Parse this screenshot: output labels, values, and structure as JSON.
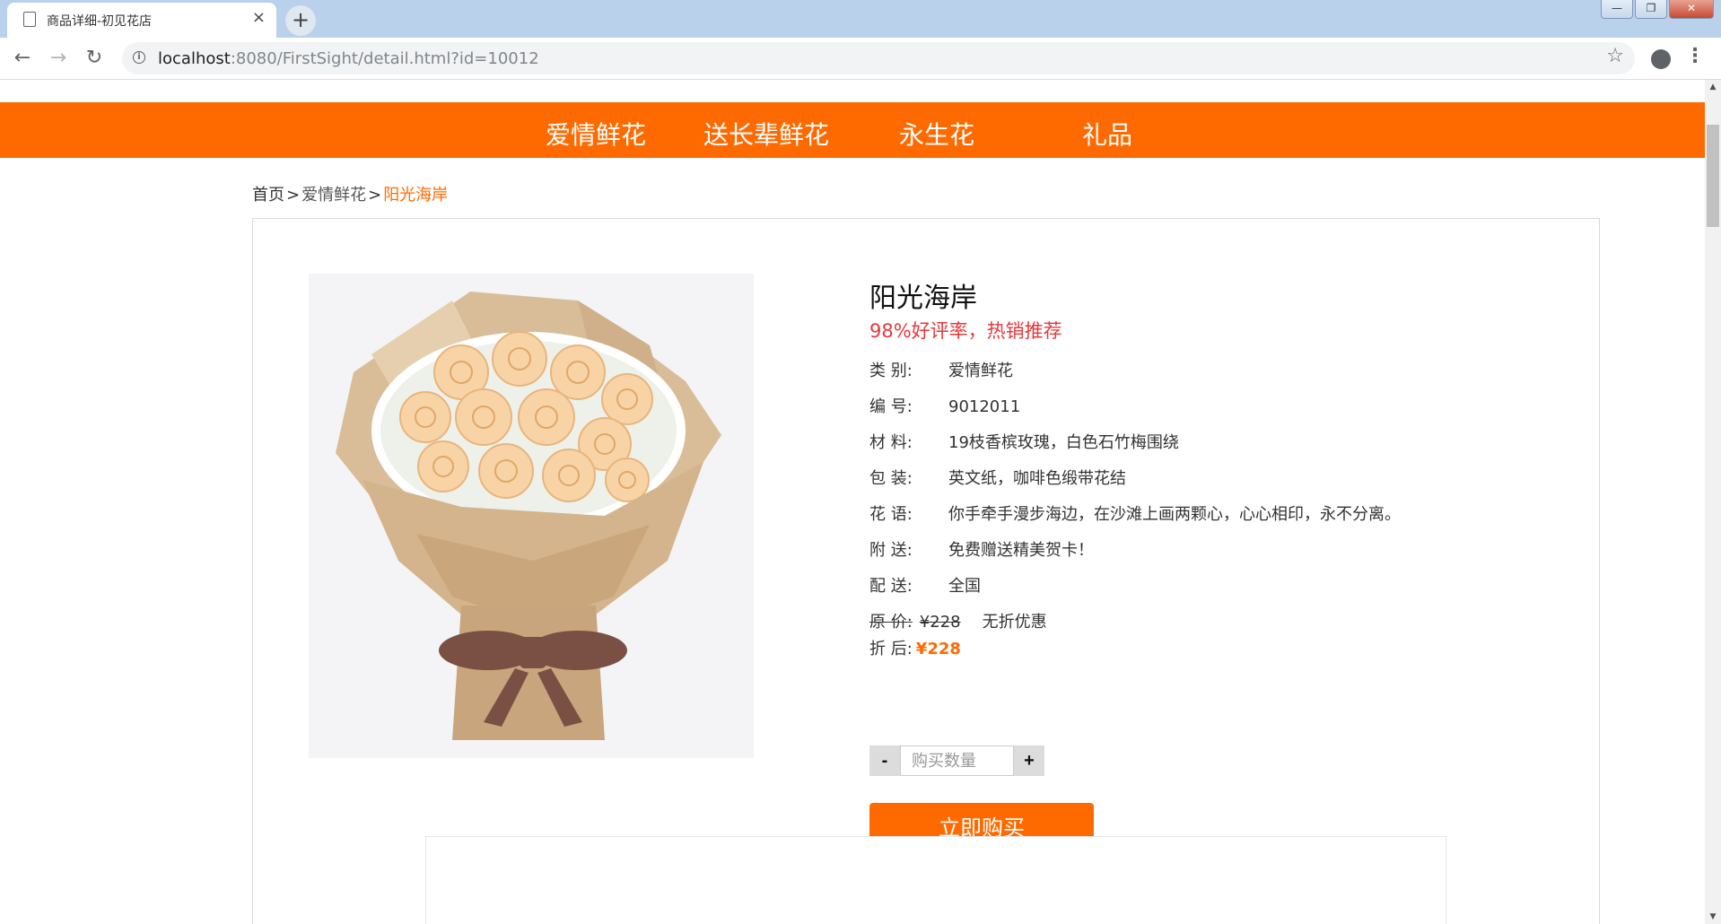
{
  "browser": {
    "tab_title": "商品详细-初见花店",
    "tab_close": "×",
    "new_tab": "+",
    "url_host": "localhost",
    "url_rest": ":8080/FirstSight/detail.html?id=10012",
    "window_buttons": [
      "—",
      "❐",
      "✕"
    ]
  },
  "nav": {
    "items": [
      {
        "label": "爱情鲜花"
      },
      {
        "label": "送长辈鲜花"
      },
      {
        "label": "永生花"
      },
      {
        "label": "礼品"
      }
    ]
  },
  "breadcrumb": {
    "home": "首页",
    "sep": ">",
    "category": "爱情鲜花",
    "current": "阳光海岸"
  },
  "product": {
    "title": "阳光海岸",
    "slogan": "98%好评率，热销推荐",
    "attributes": [
      {
        "label": "类  别:",
        "value": "爱情鲜花"
      },
      {
        "label": "编  号:",
        "value": "9012011"
      },
      {
        "label": "材  料:",
        "value": "19枝香槟玫瑰，白色石竹梅围绕"
      },
      {
        "label": "包  装:",
        "value": "英文纸，咖啡色缎带花结"
      },
      {
        "label": "花  语:",
        "value": "你手牵手漫步海边，在沙滩上画两颗心，心心相印，永不分离。"
      },
      {
        "label": "附  送:",
        "value": "免费赠送精美贺卡！"
      },
      {
        "label": "配  送:",
        "value": "全国"
      }
    ],
    "original_price_label": "原  价:",
    "original_price": "¥228",
    "discount_note": "无折优惠",
    "final_price_label": "折  后:",
    "final_price": "¥228",
    "qty_minus": "-",
    "qty_plus": "+",
    "qty_placeholder": "购买数量",
    "buy_label": "立即购买"
  },
  "colors": {
    "accent": "#ff6a00",
    "slogan": "#e4393c"
  }
}
